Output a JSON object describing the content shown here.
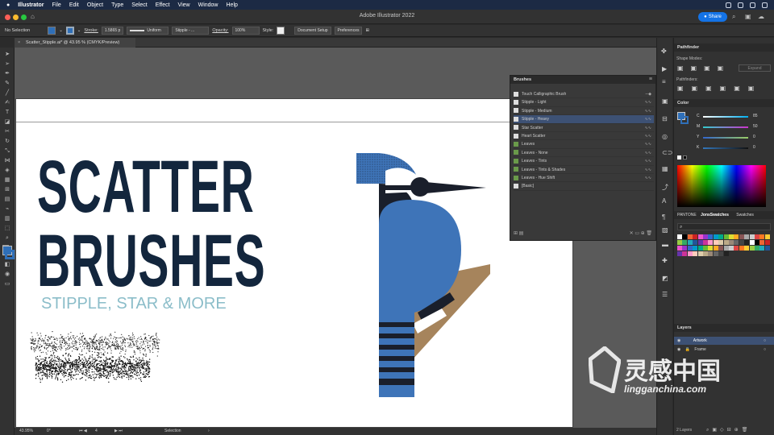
{
  "menubar": {
    "app": "Illustrator",
    "items": [
      "File",
      "Edit",
      "Object",
      "Type",
      "Select",
      "Effect",
      "View",
      "Window",
      "Help"
    ]
  },
  "title": "Adobe Illustrator 2022",
  "share": "Share",
  "options": {
    "selection": "No Selection",
    "stroke_label": "Stroke:",
    "stroke_value": "1.5865 p",
    "profile": "Uniform",
    "brush": "Stipple - ...",
    "opacity_label": "Opacity:",
    "opacity_value": "100%",
    "style_label": "Style:",
    "doc_setup": "Document Setup",
    "preferences": "Preferences"
  },
  "doc_tab": "Scatter_Stipple.ai* @ 43.95 % (CMYK/Preview)",
  "canvas": {
    "headline1": "SCATTER",
    "headline2": "BRUSHES",
    "subtitle": "STIPPLE, STAR & MORE"
  },
  "brushes": {
    "title": "Brushes",
    "items": [
      "Touch Calligraphic Brush",
      "Stipple - Light",
      "Stipple - Medium",
      "Stipple - Heavy",
      "Star Scatter",
      "Heart Scatter",
      "Leaves",
      "Leaves - None",
      "Leaves - Tints",
      "Leaves - Tints & Shades",
      "Leaves - Hue Shift",
      "[Basic]"
    ],
    "selected": 3
  },
  "pathfinder": {
    "title": "Pathfinder",
    "shape_modes": "Shape Modes:",
    "pathfinders": "Pathfinders:",
    "expand": "Expand"
  },
  "color": {
    "title": "Color",
    "channels": [
      {
        "label": "C",
        "value": "85"
      },
      {
        "label": "M",
        "value": "50"
      },
      {
        "label": "Y",
        "value": "0"
      },
      {
        "label": "K",
        "value": "0"
      }
    ]
  },
  "swatches": {
    "tabs": [
      "PANTONE",
      "JonsSwatches",
      "Swatches"
    ]
  },
  "layers": {
    "title": "Layers",
    "items": [
      "Artwork",
      "Frame"
    ],
    "count": "2 Layers"
  },
  "status": {
    "zoom": "43.95%",
    "angle": "0°",
    "page": "4",
    "mode": "Selection"
  },
  "watermark": {
    "cn": "灵感中国",
    "url": "lingganchina.com"
  },
  "colors": {
    "accent": "#1473e6",
    "navy": "#13263d",
    "bird_blue": "#3e74b8",
    "teal": "#8bbdc9",
    "tan": "#a6845c"
  }
}
